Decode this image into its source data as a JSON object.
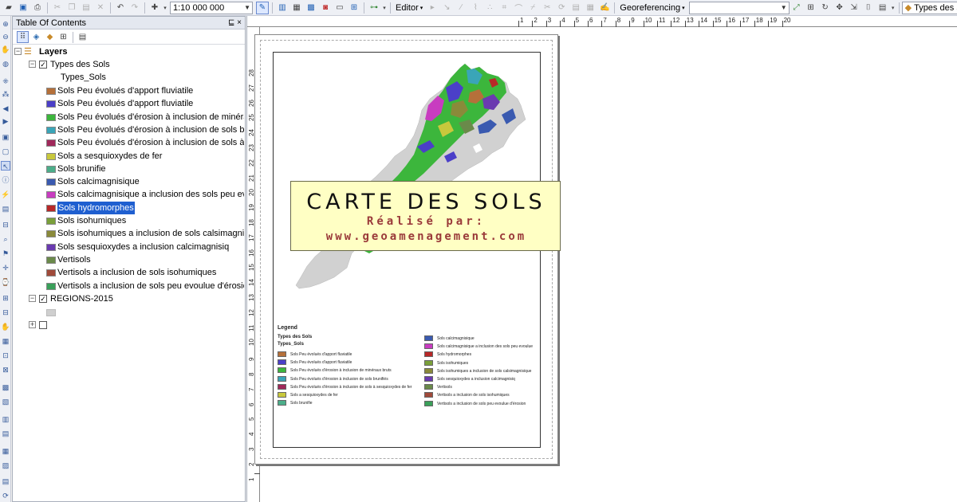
{
  "toolbar": {
    "scale": "1:10 000 000",
    "editor_label": "Editor",
    "georef_label": "Georeferencing",
    "georef_layer": "",
    "target_layer": "Types des Sols"
  },
  "toc": {
    "title": "Table Of Contents",
    "pin": "⊑ ×",
    "root": "Layers",
    "group1": "Types des Sols",
    "field": "Types_Sols",
    "items": [
      {
        "label": "Sols Peu évolués d'apport fluviatile",
        "color": "#b5703a"
      },
      {
        "label": "Sols Peu évolués d'apport fluviatile",
        "color": "#4b3fc8"
      },
      {
        "label": "Sols Peu évolués d'érosion à inclusion de minéraux",
        "color": "#3cb63c"
      },
      {
        "label": "Sols Peu évolués d'érosion à inclusion de sols brunifiés",
        "color": "#3aa5b8"
      },
      {
        "label": "Sols Peu évolués d'érosion à inclusion de sols à sesquioxydes",
        "color": "#a0285a"
      },
      {
        "label": "Sols a sesquioxydes de fer",
        "color": "#c8c83c"
      },
      {
        "label": "Sols brunifie",
        "color": "#4cae8a"
      },
      {
        "label": "Sols calcimagnisique",
        "color": "#3a5ab0"
      },
      {
        "label": "Sols calcimagnisique a inclusion des sols peu evoulue",
        "color": "#c83cc0"
      },
      {
        "label": "Sols hydromorphes",
        "color": "#b82828"
      },
      {
        "label": "Sols isohumiques",
        "color": "#7aa03a"
      },
      {
        "label": "Sols isohumiques a inclusion de sols calsimagnisique",
        "color": "#8a8a3a"
      },
      {
        "label": "Sols sesquioxydes a inclusion calcimagnisiq",
        "color": "#6a3ab0"
      },
      {
        "label": "Vertisols",
        "color": "#6a8a4a"
      },
      {
        "label": "Vertisols a inclusion de sols isohumiques",
        "color": "#a04a3a"
      },
      {
        "label": "Vertisols a inclusion de sols peu evoulue d'érosion",
        "color": "#3aa05a"
      }
    ],
    "group2": "REGIONS-2015",
    "group2_color": "#cfcfcf",
    "group3": ""
  },
  "ruler": {
    "top": [
      "1",
      "2",
      "3",
      "4",
      "5",
      "6",
      "7",
      "8",
      "9",
      "10",
      "11",
      "12",
      "13",
      "14",
      "15",
      "16",
      "17",
      "18",
      "19",
      "20"
    ],
    "left": [
      "28",
      "27",
      "26",
      "25",
      "24",
      "23",
      "22",
      "21",
      "20",
      "19",
      "18",
      "17",
      "16",
      "15",
      "14",
      "13",
      "12",
      "11",
      "10",
      "9",
      "8",
      "7",
      "6",
      "5",
      "4",
      "3",
      "2",
      "1"
    ]
  },
  "title_box": {
    "line1": "CARTE DES SOLS",
    "line2": "Réalisé par:",
    "line3": "www.geoamenagement.com"
  },
  "legend": {
    "heading": "Legend",
    "layer": "Types des Sols",
    "field": "Types_Sols",
    "col1": [
      {
        "label": "Sols Peu évolués d'apport fluviatile",
        "color": "#b5703a"
      },
      {
        "label": "Sols Peu évolués d'apport fluviatile",
        "color": "#4b3fc8"
      },
      {
        "label": "Sols Peu évolués d'érosion à inclusion de minéraux bruts",
        "color": "#3cb63c"
      },
      {
        "label": "Sols Peu évolués d'érosion à inclusion de sols brunifiés",
        "color": "#3aa5b8"
      },
      {
        "label": "Sols Peu évolués d'érosion à inclusion de sols à sesquioxydes de fer",
        "color": "#a0285a"
      },
      {
        "label": "Sols a sesquioxydes de fer",
        "color": "#c8c83c"
      },
      {
        "label": "Sols brunifie",
        "color": "#4cae8a"
      }
    ],
    "col2": [
      {
        "label": "Sols calcimagnisique",
        "color": "#3a5ab0"
      },
      {
        "label": "Sols calcimagnisique a inclusion des sols peu evoulue",
        "color": "#c83cc0"
      },
      {
        "label": "Sols hydromorphes",
        "color": "#b82828"
      },
      {
        "label": "Sols isohumiques",
        "color": "#7aa03a"
      },
      {
        "label": "Sols isohumiques a inclusion de sols calsimagnisique",
        "color": "#8a8a3a"
      },
      {
        "label": "Sols sesquioxydes a inclusion calcimagnisiq",
        "color": "#6a3ab0"
      },
      {
        "label": "Vertisols",
        "color": "#6a8a4a"
      },
      {
        "label": "Vertisols a inclusion de sols isohumiques",
        "color": "#a04a3a"
      },
      {
        "label": "Vertisols a inclusion de sols peu evoulue d'érosion",
        "color": "#3aa05a"
      }
    ]
  }
}
